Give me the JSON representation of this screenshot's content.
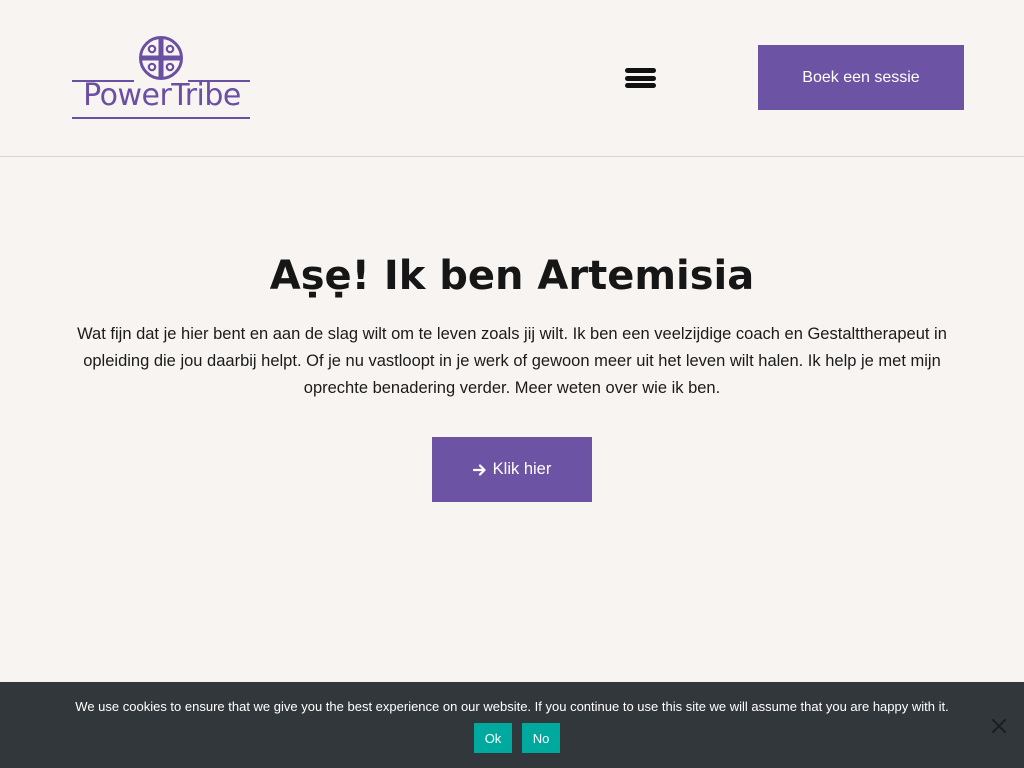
{
  "header": {
    "logo_text": "PowerTribe",
    "book_button_label": "Boek een sessie",
    "menu_icon": "hamburger-menu-icon"
  },
  "hero": {
    "title": "Aṣẹ! Ik ben Artemisia",
    "intro": "Wat fijn dat je hier bent en aan de slag wilt om te leven zoals jij wilt. Ik ben een veelzijdige coach en Gestalttherapeut in opleiding die jou daarbij helpt. Of je nu vastloopt in je werk of gewoon meer uit het leven wilt halen. Ik help je met mijn oprechte benadering verder. Meer weten over wie ik ben.",
    "cta_label": "Klik hier",
    "cta_icon": "arrow-right-icon"
  },
  "cookie_notice": {
    "text": "We use cookies to ensure that we give you the best experience on our website. If you continue to use this site we will assume that you are happy with it.",
    "ok_label": "Ok",
    "no_label": "No",
    "close_icon": "close-icon"
  },
  "colors": {
    "brand_purple": "#6c53a3",
    "page_background": "#f7f4f1",
    "cookie_bar_background": "#32373c",
    "cookie_button": "#00a99d"
  }
}
